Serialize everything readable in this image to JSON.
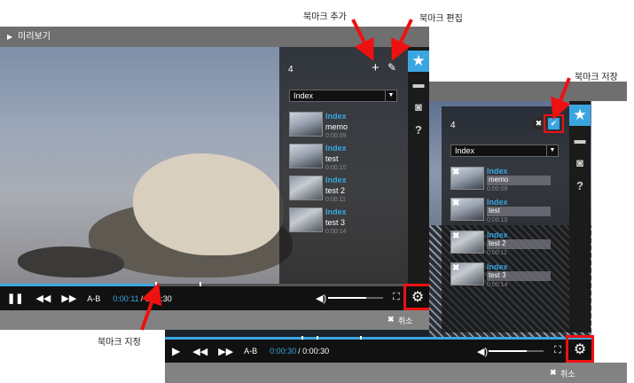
{
  "window": {
    "title": "미리보기"
  },
  "annotations": {
    "add": "북마크 추가",
    "edit": "북마크 편집",
    "save": "북마크 저장",
    "set": "북마크 지정"
  },
  "player1": {
    "bookmark_count": "4",
    "select_value": "Index",
    "bookmarks": [
      {
        "title": "Index",
        "memo": "memo",
        "time": "0:00:09"
      },
      {
        "title": "Index",
        "memo": "test",
        "time": "0:00:10"
      },
      {
        "title": "Index",
        "memo": "test 2",
        "time": "0:00:11"
      },
      {
        "title": "Index",
        "memo": "test 3",
        "time": "0:00:14"
      }
    ],
    "ab": "A-B",
    "time_current": "0:00:11",
    "time_total": "/ 0:00:30",
    "cancel_label": "취소",
    "volume_level": 0.7
  },
  "player2": {
    "bookmark_count": "4",
    "select_value": "Index",
    "bookmarks": [
      {
        "title": "Index",
        "memo": "memo",
        "time": "0:00:09"
      },
      {
        "title": "Index",
        "memo": "test",
        "time": "0:00:10"
      },
      {
        "title": "Index",
        "memo": "test 2",
        "time": "0:00:11"
      },
      {
        "title": "Index",
        "memo": "test 3",
        "time": "0:00:14"
      }
    ],
    "ab": "A-B",
    "time_current": "0:00:30",
    "time_total": "/ 0:00:30",
    "cancel_label": "취소",
    "volume_level": 0.7
  },
  "icons": {
    "play": "play-icon",
    "pause": "pause-icon",
    "rewind": "rewind-icon",
    "forward": "fast-forward-icon",
    "volume": "volume-icon",
    "fullscreen": "fullscreen-icon",
    "settings": "gear-icon",
    "star": "star-icon",
    "chat": "chat-icon",
    "camera": "camera-icon",
    "help": "help-icon",
    "add": "plus-icon",
    "edit": "edit-icon",
    "confirm": "check-icon",
    "delete": "close-icon"
  },
  "colors": {
    "accent": "#3aa6e0",
    "highlight": "#e11111"
  }
}
